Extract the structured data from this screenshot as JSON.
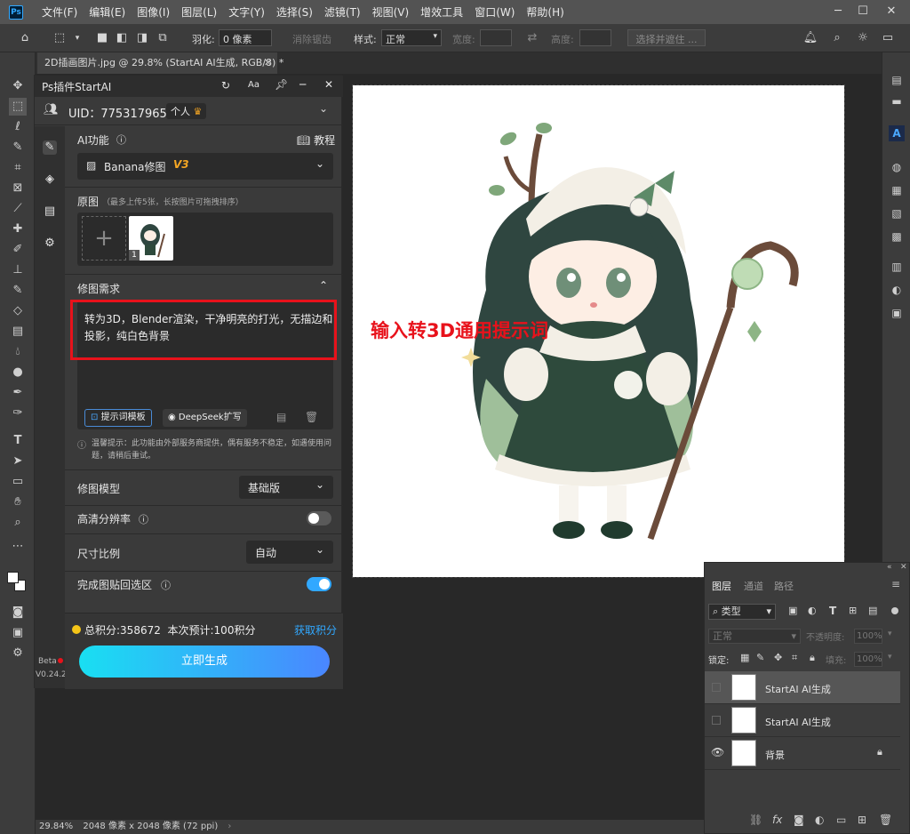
{
  "app": {
    "menu": [
      "文件(F)",
      "编辑(E)",
      "图像(I)",
      "图层(L)",
      "文字(Y)",
      "选择(S)",
      "滤镜(T)",
      "视图(V)",
      "增效工具",
      "窗口(W)",
      "帮助(H)"
    ],
    "logo": "Ps"
  },
  "options": {
    "feather_label": "羽化:",
    "feather_value": "0 像素",
    "antialias_label": "消除锯齿",
    "style_label": "样式:",
    "style_value": "正常",
    "width_label": "宽度:",
    "height_label": "高度:",
    "select_mask": "选择并遮住 ..."
  },
  "document": {
    "tab_title": "2D插画图片.jpg @ 29.8% (StartAI AI生成, RGB/8) *",
    "overlay_text": "输入转3D通用提示词"
  },
  "status": {
    "zoom": "29.84%",
    "info": "2048 像素 x 2048 像素 (72 ppi)"
  },
  "plugin": {
    "title": "Ps插件StartAI",
    "uid": "UID：775317965",
    "account_type": "个人",
    "ai_function_label": "AI功能",
    "tutorial": "教程",
    "function_value": "Banana修图",
    "function_version": "V3",
    "source_label": "原图",
    "source_hint": "（最多上传5张，长按图片可拖拽排序）",
    "thumb_index": "1",
    "requirement_label": "修图需求",
    "prompt_text": "转为3D，Blender渲染，干净明亮的打光，无描边和投影，纯白色背景",
    "template_button": "提示词模板",
    "deepseek_button": "DeepSeek扩写",
    "notice": "温馨提示：此功能由外部服务商提供，偶有服务不稳定，如遇使用问题，请稍后重试。",
    "model_label": "修图模型",
    "model_value": "基础版",
    "hd_label": "高清分辨率",
    "hd_on": false,
    "ratio_label": "尺寸比例",
    "ratio_value": "自动",
    "paste_back_label": "完成图贴回选区",
    "paste_back_on": true,
    "points_label": "总积分:",
    "points_value": "358672",
    "estimate_label": "本次预计:",
    "estimate_value": "100积分",
    "get_points": "获取积分",
    "generate_button": "立即生成",
    "beta": "Beta",
    "version": "V0.24.2"
  },
  "layers": {
    "tabs": [
      "图层",
      "通道",
      "路径"
    ],
    "filter_value": "类型",
    "blend_value": "正常",
    "opacity_label": "不透明度:",
    "opacity_value": "100%",
    "lock_label": "锁定:",
    "fill_label": "填充:",
    "fill_value": "100%",
    "items": [
      {
        "name": "StartAI AI生成",
        "visible": false
      },
      {
        "name": "StartAI AI生成",
        "visible": false
      },
      {
        "name": "背景",
        "visible": true,
        "locked": true
      }
    ]
  },
  "colors": {
    "accent_blue": "#31a8ff",
    "highlight_red": "#e8121b",
    "generate_gradient_start": "#19dff2",
    "generate_gradient_end": "#4a86ff",
    "version_orange": "#f5a623"
  }
}
